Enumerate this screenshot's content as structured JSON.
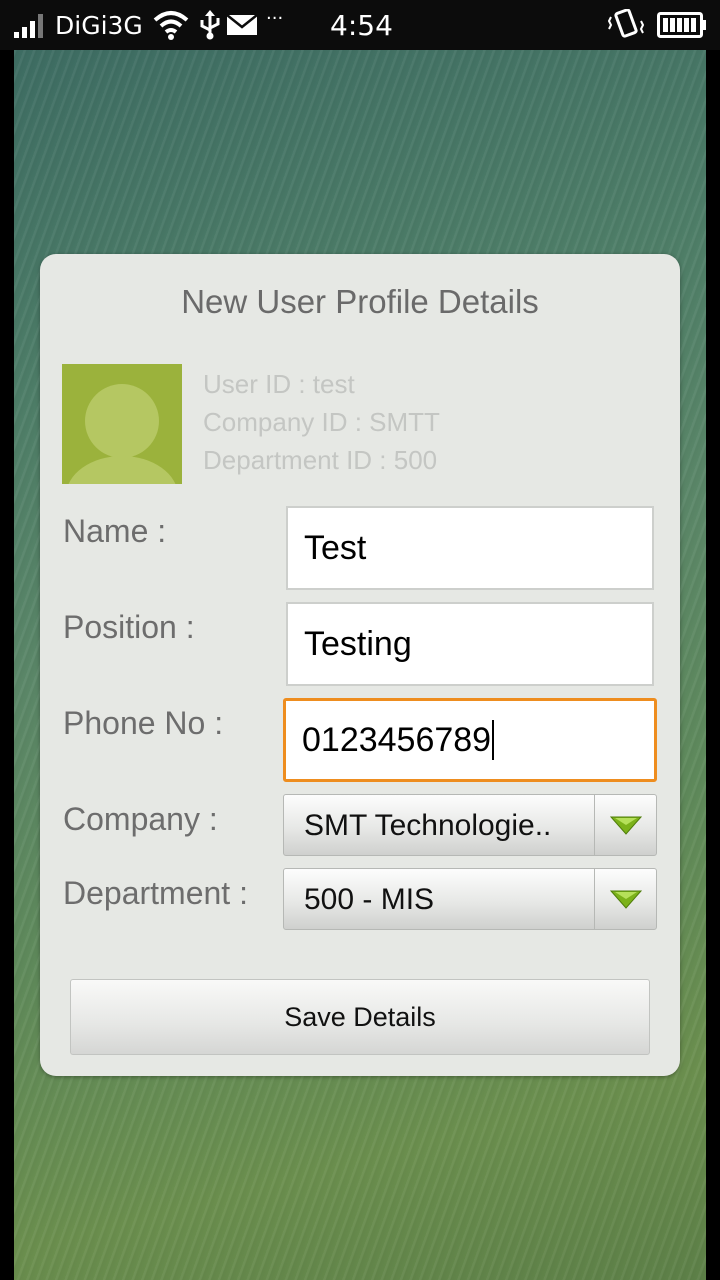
{
  "status_bar": {
    "carrier": "DiGi3G",
    "more_indicator": "···",
    "time": "4:54",
    "icons": [
      "signal-icon",
      "wifi-icon",
      "usb-icon",
      "mail-icon",
      "vibrate-icon",
      "battery-icon"
    ]
  },
  "dialog": {
    "title": "New User Profile Details",
    "user_info": {
      "user_id": "User ID : test",
      "company_id": "Company ID : SMTT",
      "department_id": "Department ID : 500"
    },
    "form": {
      "name_label": "Name :",
      "name_value": "Test",
      "position_label": "Position :",
      "position_value": "Testing",
      "phone_label": "Phone No :",
      "phone_value": "0123456789",
      "company_label": "Company :",
      "company_value": "SMT Technologie..",
      "department_label": "Department :",
      "department_value": "500 - MIS"
    },
    "save_label": "Save Details"
  },
  "colors": {
    "focus_border": "#ee8d1f",
    "avatar_bg": "#9bb23c",
    "dropdown_arrow": "#7cb21a"
  }
}
